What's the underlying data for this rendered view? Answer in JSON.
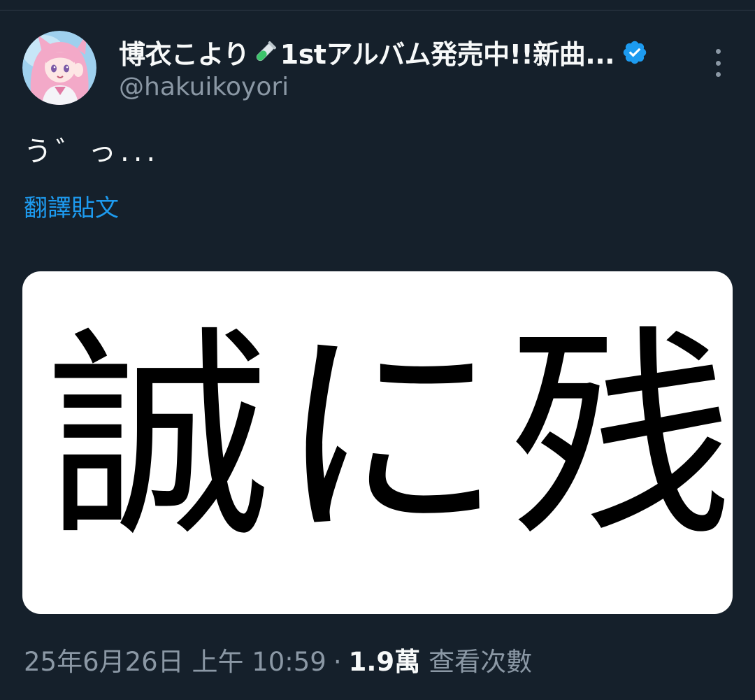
{
  "tweet": {
    "display_name_prefix": "博衣こより",
    "display_name_suffix": "1stアルバム発売中!!新曲...",
    "handle": "@hakuikoyori",
    "text": "う゛っ...",
    "translate_label": "翻譯貼文",
    "media_text": "誠に残",
    "timestamp": "25年6月26日 上午 10:59",
    "separator": "·",
    "views_count": "1.9萬",
    "views_label": "查看次數"
  },
  "icons": {
    "avatar": "avatar-anime-girl",
    "tube": "test-tube-icon",
    "verified": "verified-badge-icon",
    "more": "more-options-icon"
  },
  "colors": {
    "background": "#15202b",
    "link": "#1d9bf0",
    "secondary_text": "#8b98a5",
    "primary_text": "#f7f9f9",
    "verified": "#1d9bf0"
  }
}
